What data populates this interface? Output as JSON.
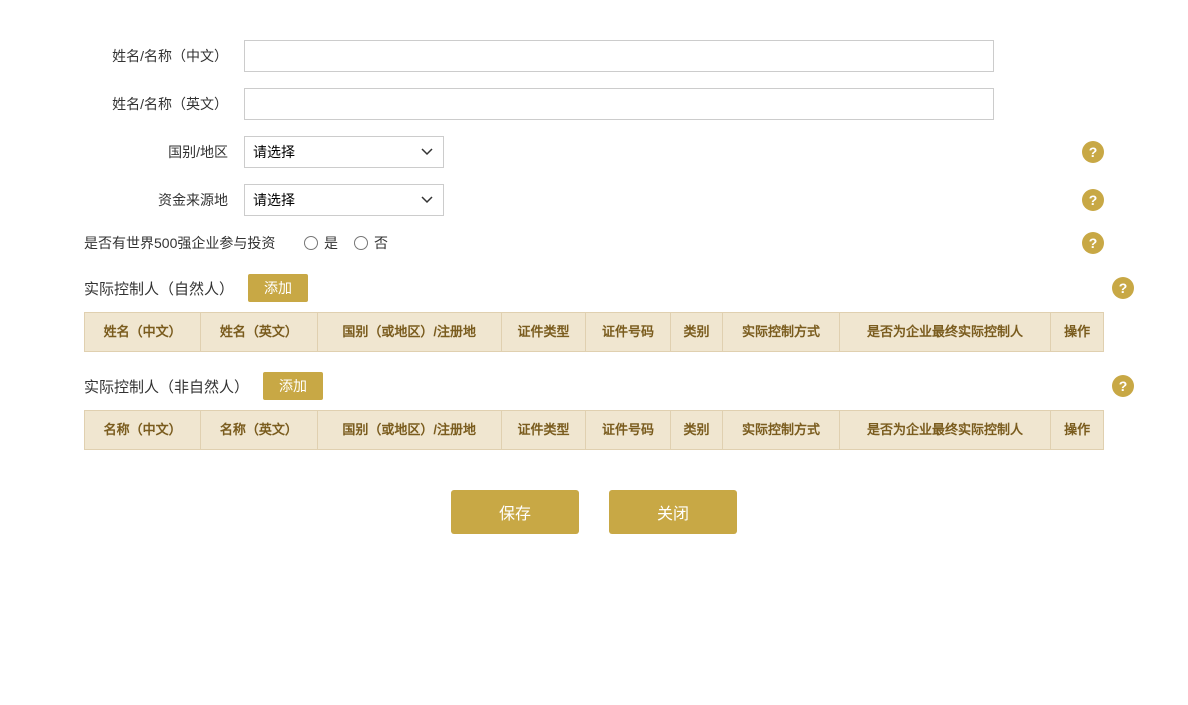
{
  "form": {
    "name_cn_label": "姓名/名称（中文）",
    "name_en_label": "姓名/名称（英文）",
    "country_label": "国别/地区",
    "country_placeholder": "请选择",
    "fund_source_label": "资金来源地",
    "fund_source_placeholder": "请选择",
    "fortune500_label": "是否有世界500强企业参与投资",
    "yes_label": "是",
    "no_label": "否"
  },
  "natural_person_section": {
    "title": "实际控制人（自然人）",
    "add_button": "添加",
    "columns": [
      "姓名（中文）",
      "姓名（英文）",
      "国别（或地区）/注册地",
      "证件类型",
      "证件号码",
      "类别",
      "实际控制方式",
      "是否为企业最终实际控制人",
      "操作"
    ]
  },
  "non_natural_person_section": {
    "title": "实际控制人（非自然人）",
    "add_button": "添加",
    "columns": [
      "名称（中文）",
      "名称（英文）",
      "国别（或地区）/注册地",
      "证件类型",
      "证件号码",
      "类别",
      "实际控制方式",
      "是否为企业最终实际控制人",
      "操作"
    ]
  },
  "buttons": {
    "save": "保存",
    "close": "关闭"
  },
  "icons": {
    "help": "?",
    "chevron": "▾"
  }
}
